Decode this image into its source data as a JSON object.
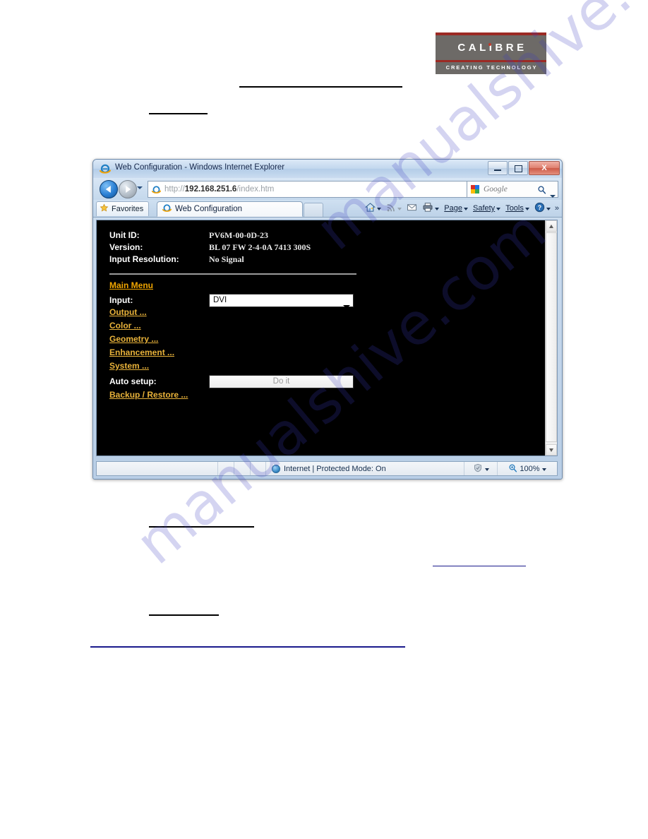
{
  "logo": {
    "name": "CALIBRE",
    "tagline": "CREATING TECHNOLOGY"
  },
  "watermark": {
    "line1": "manualshive.com",
    "line2": "manualshive.com"
  },
  "browser": {
    "title": "Web Configuration - Windows Internet Explorer",
    "window_controls": {
      "minimize": "Minimize",
      "maximize": "Maximize",
      "close": "X"
    },
    "address": {
      "protocol": "http://",
      "host": "192.168.251.6",
      "path": "/index.htm",
      "full_url": "http://192.168.251.6/index.htm"
    },
    "search": {
      "placeholder": "Google",
      "value": ""
    },
    "favorites_label": "Favorites",
    "tab_label": "Web Configuration",
    "command_bar": [
      {
        "label": "",
        "icon": "home-icon",
        "has_caret": true
      },
      {
        "label": "",
        "icon": "rss-feed-icon",
        "has_caret": true
      },
      {
        "label": "",
        "icon": "read-mail-icon",
        "has_caret": false
      },
      {
        "label": "",
        "icon": "print-icon",
        "has_caret": true
      },
      {
        "label": "Page",
        "icon": "",
        "has_caret": true
      },
      {
        "label": "Safety",
        "icon": "",
        "has_caret": true
      },
      {
        "label": "Tools",
        "icon": "",
        "has_caret": true
      },
      {
        "label": "",
        "icon": "help-icon",
        "has_caret": true
      }
    ],
    "overflow_label": "»",
    "status": {
      "zone": "Internet | Protected Mode: On",
      "zoom": "100%"
    }
  },
  "page": {
    "info": [
      {
        "label": "Unit ID:",
        "value": "PV6M-00-0D-23"
      },
      {
        "label": "Version:",
        "value": "BL 07 FW 2-4-0A 7413 300S"
      },
      {
        "label": "Input Resolution:",
        "value": "No Signal"
      }
    ],
    "main_menu_label": "Main Menu",
    "input_label": "Input:",
    "input_value": "DVI",
    "input_options": [
      "DVI"
    ],
    "links": [
      "Output ...",
      "Color ...",
      "Geometry ...",
      "Enhancement ...",
      "System ..."
    ],
    "auto_setup_label": "Auto setup:",
    "auto_setup_button": "Do it",
    "backup_restore_label": "Backup / Restore ..."
  },
  "colors": {
    "page_background": "#000000",
    "link_gold": "#e8b23a",
    "heading_gold": "#f0a500",
    "logo_grey": "#6d6a67",
    "logo_red": "#9c2a24",
    "footer_rule_blue": "#1a1a8c"
  }
}
